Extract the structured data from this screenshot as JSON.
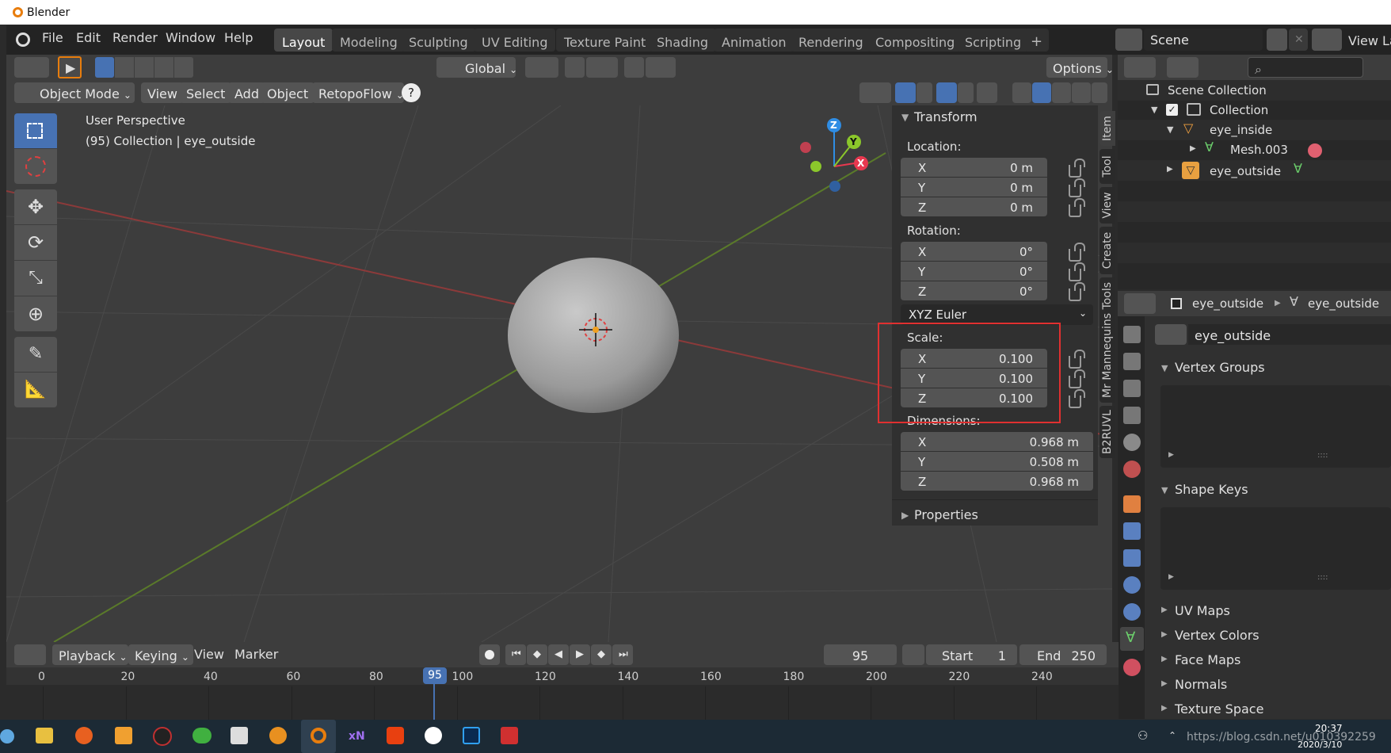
{
  "window": {
    "title": "Blender"
  },
  "menubar": {
    "items": [
      "File",
      "Edit",
      "Render",
      "Window",
      "Help"
    ],
    "workspaces": [
      "Layout",
      "Modeling",
      "Sculpting",
      "UV Editing",
      "Texture Paint",
      "Shading",
      "Animation",
      "Rendering",
      "Compositing",
      "Scripting"
    ],
    "active_workspace": "Layout",
    "add_tab": "+",
    "scene_label": "Scene",
    "viewlayer_label": "View La"
  },
  "toolheader": {
    "orientation": "Global",
    "options": "Options"
  },
  "viewport_header": {
    "mode": "Object Mode",
    "menus": [
      "View",
      "Select",
      "Add",
      "Object"
    ],
    "addon": "RetopoFlow",
    "help": "?"
  },
  "viewport": {
    "perspective": "User Perspective",
    "collection_info": "(95) Collection | eye_outside",
    "gizmo": {
      "x": "X",
      "y": "Y",
      "z": "Z"
    }
  },
  "npanel": {
    "section": "Transform",
    "location_label": "Location:",
    "location": [
      {
        "axis": "X",
        "value": "0 m"
      },
      {
        "axis": "Y",
        "value": "0 m"
      },
      {
        "axis": "Z",
        "value": "0 m"
      }
    ],
    "rotation_label": "Rotation:",
    "rotation": [
      {
        "axis": "X",
        "value": "0°"
      },
      {
        "axis": "Y",
        "value": "0°"
      },
      {
        "axis": "Z",
        "value": "0°"
      }
    ],
    "rotation_mode": "XYZ Euler",
    "scale_label": "Scale:",
    "scale": [
      {
        "axis": "X",
        "value": "0.100"
      },
      {
        "axis": "Y",
        "value": "0.100"
      },
      {
        "axis": "Z",
        "value": "0.100"
      }
    ],
    "dimensions_label": "Dimensions:",
    "dimensions": [
      {
        "axis": "X",
        "value": "0.968 m"
      },
      {
        "axis": "Y",
        "value": "0.508 m"
      },
      {
        "axis": "Z",
        "value": "0.968 m"
      }
    ],
    "properties": "Properties",
    "tabs": [
      "Item",
      "Tool",
      "View",
      "Create",
      "Mr Mannequins Tools",
      "B2RUVL"
    ],
    "highlight_color": "#e03030"
  },
  "outliner": {
    "root": "Scene Collection",
    "collection": "Collection",
    "items": [
      "eye_inside",
      "Mesh.003",
      "eye_outside"
    ]
  },
  "properties": {
    "breadcrumb_object": "eye_outside",
    "breadcrumb_data": "eye_outside",
    "mesh_name": "eye_outside",
    "panels": [
      "Vertex Groups",
      "Shape Keys",
      "UV Maps",
      "Vertex Colors",
      "Face Maps",
      "Normals",
      "Texture Space"
    ]
  },
  "timeline": {
    "menus": [
      "Playback",
      "Keying",
      "View",
      "Marker"
    ],
    "current_frame": "95",
    "start_label": "Start",
    "start_value": "1",
    "end_label": "End",
    "end_value": "250",
    "ruler": [
      "0",
      "20",
      "40",
      "60",
      "80",
      "100",
      "120",
      "140",
      "160",
      "180",
      "200",
      "220",
      "240"
    ]
  },
  "taskbar": {
    "time": "20:37",
    "date": "2020/3/10",
    "watermark": "https://blog.csdn.net/u010392259"
  },
  "colors": {
    "accent": "#4772b3",
    "x_axis": "#e8384f",
    "y_axis": "#8bc72b",
    "z_axis": "#2f8de4"
  }
}
